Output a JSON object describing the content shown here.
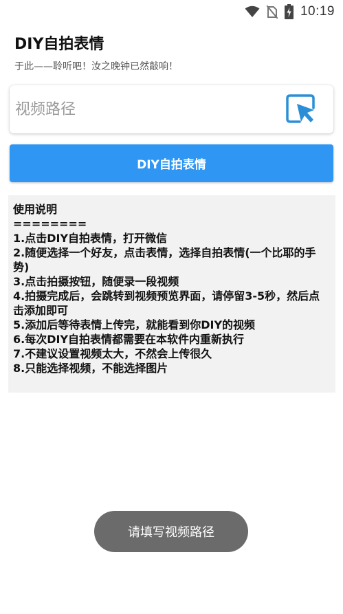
{
  "status_bar": {
    "time": "10:19",
    "icons": [
      "wifi-icon",
      "no-sim-icon",
      "battery-charging-icon"
    ]
  },
  "header": {
    "title": "DIY自拍表情",
    "subtitle": "于此——聆听吧！汝之晚钟已然敲响！"
  },
  "path_input": {
    "placeholder": "视频路径",
    "value": "",
    "picker_icon": "cursor-select-icon",
    "picker_color": "#2a8fd6"
  },
  "primary_button": {
    "label": "DIY自拍表情",
    "color": "#2f97f3"
  },
  "instructions": {
    "title": "使用说明",
    "separator": "========",
    "lines": [
      "1.点击DIY自拍表情，打开微信",
      "2.随便选择一个好友，点击表情，选择自拍表情(一个比耶的手势)",
      "3.点击拍摄按钮，随便录一段视频",
      "4.拍摄完成后，会跳转到视频预览界面，请停留3-5秒，然后点击添加即可",
      "5.添加后等待表情上传完，就能看到你DIY的视频",
      "6.每次DIY自拍表情都需要在本软件内重新执行",
      "7.不建议设置视频太大，不然会上传很久",
      "8.只能选择视频，不能选择图片"
    ]
  },
  "toast": {
    "message": "请填写视频路径"
  }
}
